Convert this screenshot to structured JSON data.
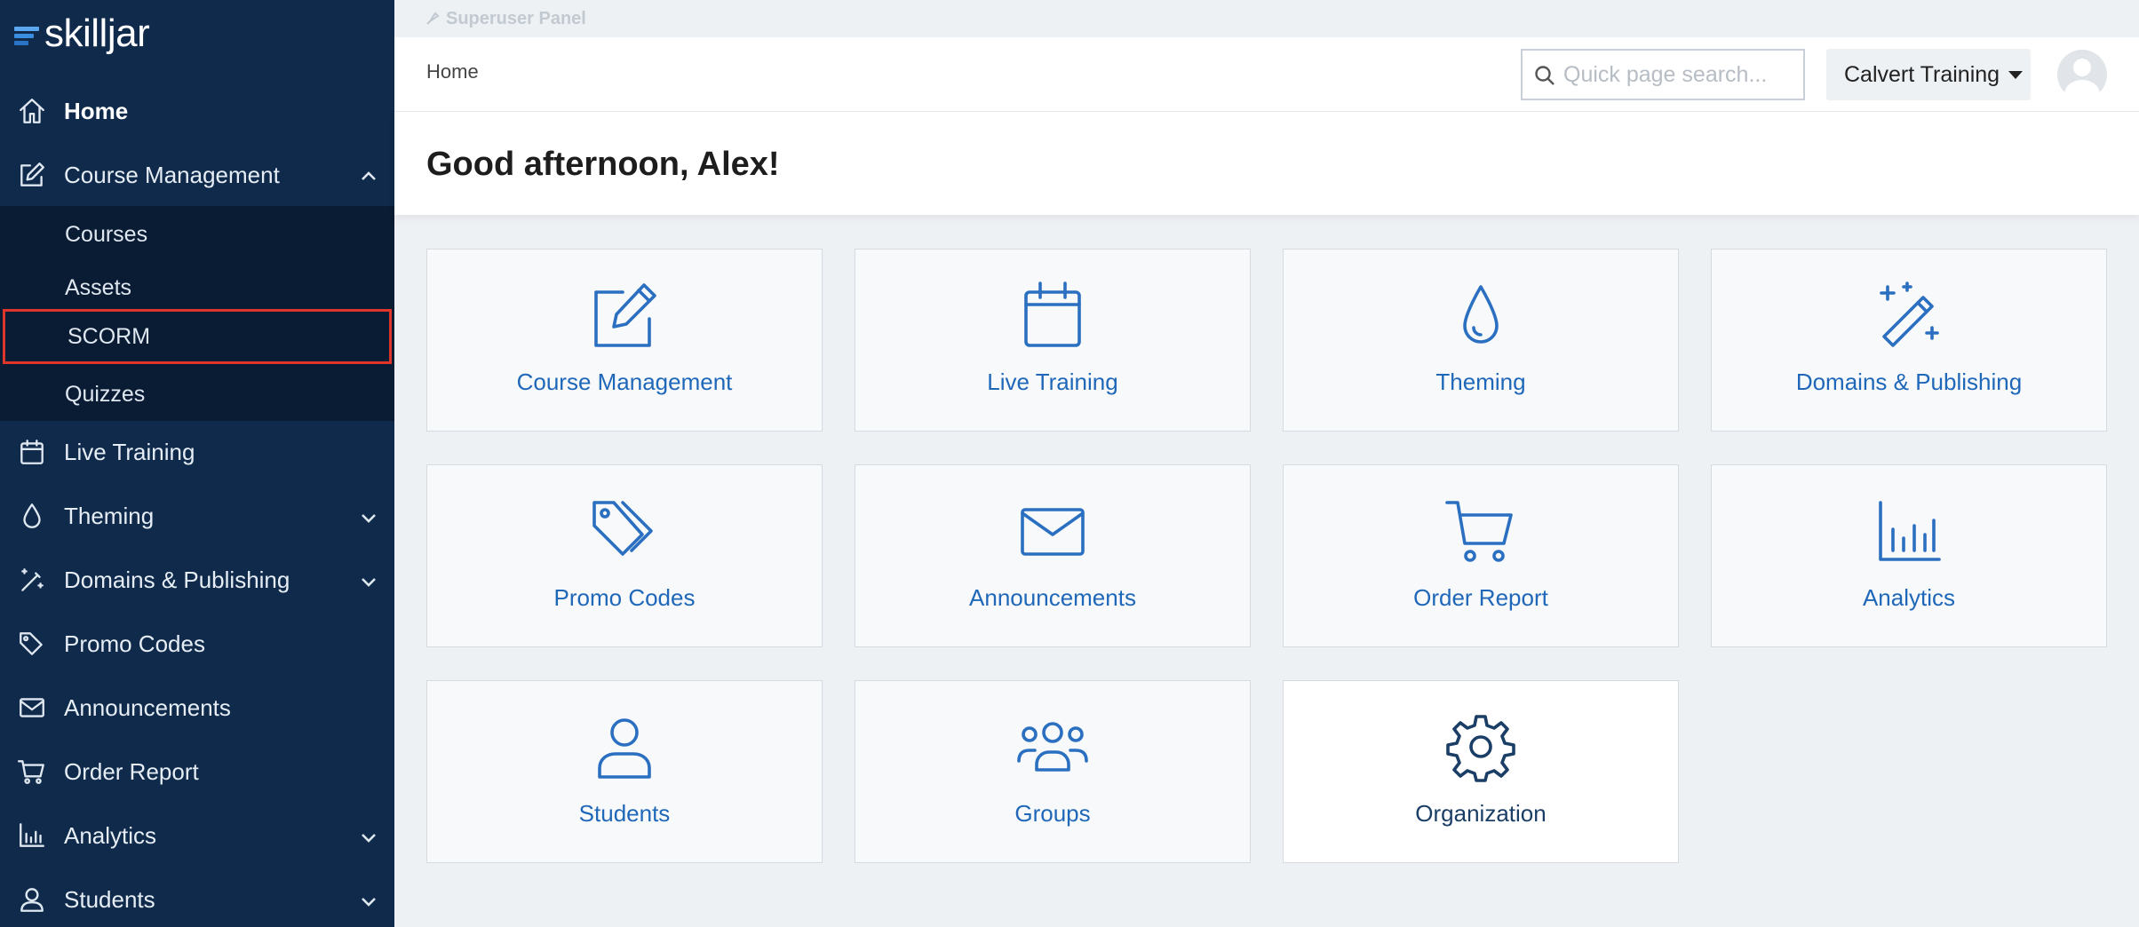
{
  "brand": {
    "name": "skilljar"
  },
  "superuser": {
    "label": "Superuser Panel"
  },
  "header": {
    "breadcrumb": "Home",
    "search_placeholder": "Quick page search...",
    "org_name": "Calvert Training"
  },
  "greeting": "Good afternoon, Alex!",
  "sidebar": {
    "items": [
      {
        "label": "Home",
        "icon": "home-icon"
      },
      {
        "label": "Course Management",
        "icon": "edit-icon"
      },
      {
        "label": "Live Training",
        "icon": "calendar-icon"
      },
      {
        "label": "Theming",
        "icon": "droplet-icon"
      },
      {
        "label": "Domains & Publishing",
        "icon": "magic-wand-icon"
      },
      {
        "label": "Promo Codes",
        "icon": "tag-icon"
      },
      {
        "label": "Announcements",
        "icon": "envelope-icon"
      },
      {
        "label": "Order Report",
        "icon": "cart-icon"
      },
      {
        "label": "Analytics",
        "icon": "bar-chart-icon"
      },
      {
        "label": "Students",
        "icon": "user-icon"
      }
    ],
    "submenu": [
      "Courses",
      "Assets",
      "SCORM",
      "Quizzes"
    ]
  },
  "tiles": [
    {
      "label": "Course Management",
      "icon": "edit-icon"
    },
    {
      "label": "Live Training",
      "icon": "calendar-icon"
    },
    {
      "label": "Theming",
      "icon": "droplet-icon"
    },
    {
      "label": "Domains & Publishing",
      "icon": "magic-wand-icon"
    },
    {
      "label": "Promo Codes",
      "icon": "tag-icon"
    },
    {
      "label": "Announcements",
      "icon": "envelope-icon"
    },
    {
      "label": "Order Report",
      "icon": "cart-icon"
    },
    {
      "label": "Analytics",
      "icon": "bar-chart-icon"
    },
    {
      "label": "Students",
      "icon": "user-icon"
    },
    {
      "label": "Groups",
      "icon": "group-icon"
    },
    {
      "label": "Organization",
      "icon": "gear-icon"
    }
  ],
  "colors": {
    "sidebar_bg": "#0f2a4a",
    "submenu_bg": "#0a1c33",
    "accent": "#1f67b8",
    "highlight_border": "#e0352b"
  }
}
